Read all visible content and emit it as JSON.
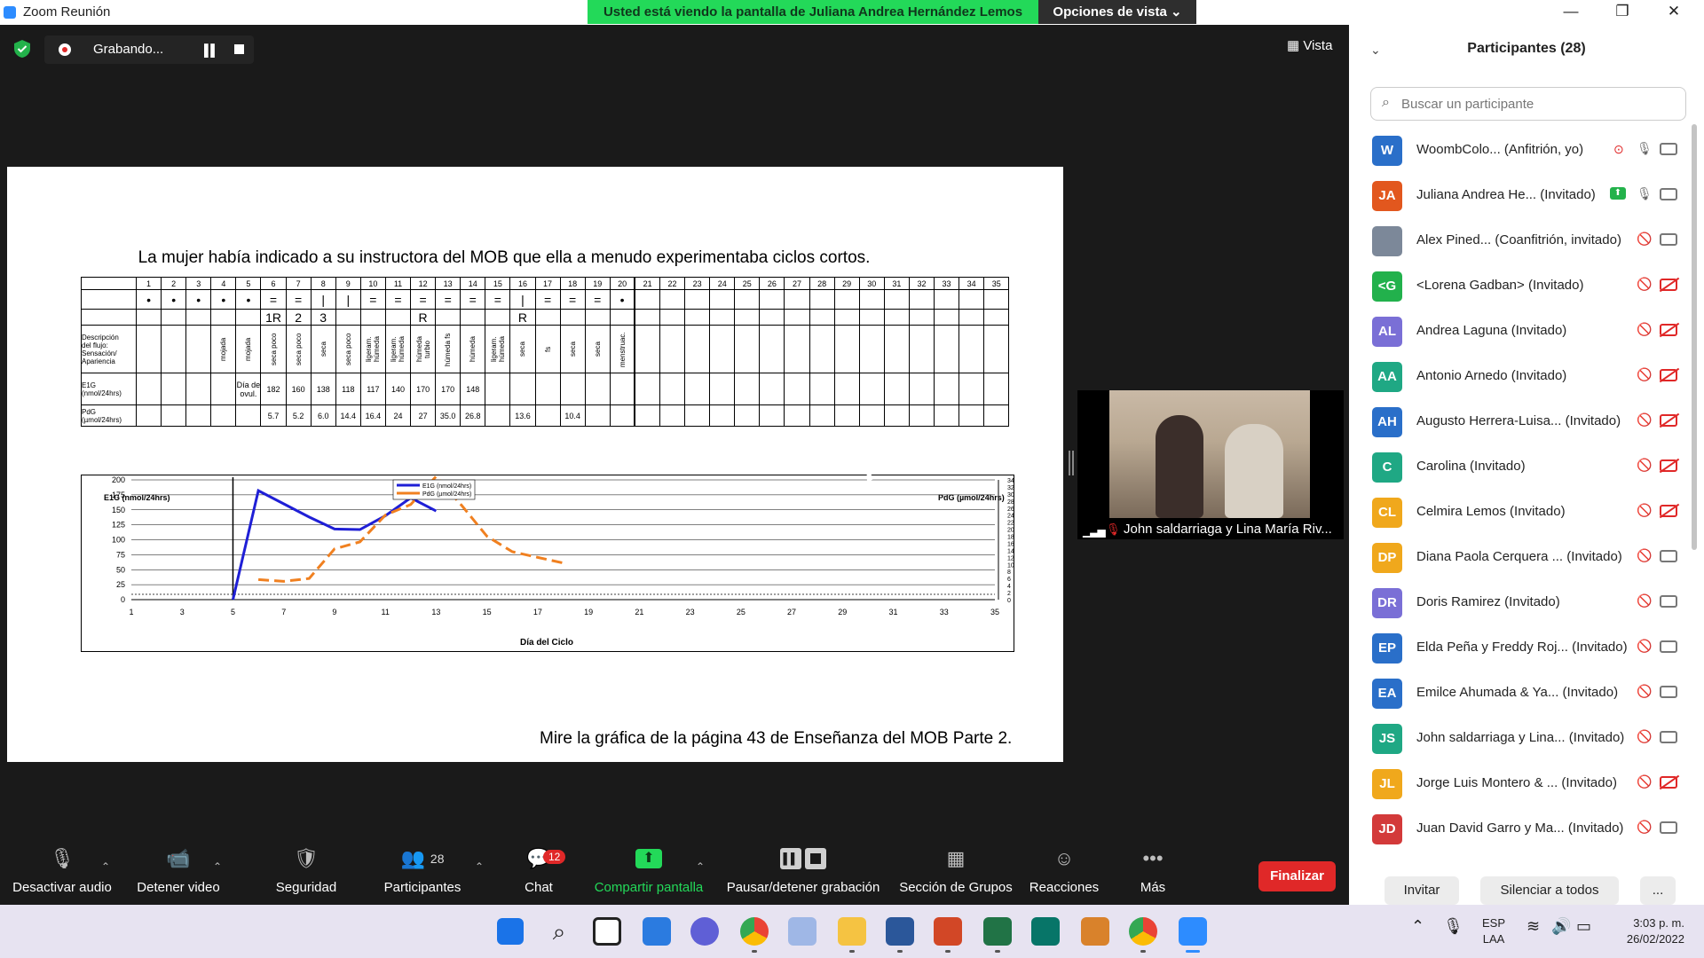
{
  "window": {
    "title": "Zoom Reunión",
    "share_banner": "Usted está viendo la pantalla de Juliana Andrea Hernández Lemos",
    "view_options": "Opciones de vista"
  },
  "recording": {
    "status": "Grabando..."
  },
  "view_button": "Vista",
  "slide": {
    "title": "La mujer había indicado a su instructora del MOB que ella a menudo experimentaba ciclos cortos.",
    "footer": "Mire la gráfica de la página 43 de Enseñanza del MOB Parte 2.",
    "days": [
      "1",
      "2",
      "3",
      "4",
      "5",
      "6",
      "7",
      "8",
      "9",
      "10",
      "11",
      "12",
      "13",
      "14",
      "15",
      "16",
      "17",
      "18",
      "19",
      "20",
      "21",
      "22",
      "23",
      "24",
      "25",
      "26",
      "27",
      "28",
      "29",
      "30",
      "31",
      "32",
      "33",
      "34",
      "35"
    ],
    "symbols": [
      "•",
      "•",
      "•",
      "•",
      "•",
      "=",
      "=",
      "|",
      "|",
      "=",
      "=",
      "=",
      "=",
      "=",
      "=",
      "|",
      "=",
      "=",
      "=",
      "•",
      "",
      "",
      "",
      "",
      "",
      "",
      "",
      "",
      "",
      "",
      "",
      "",
      "",
      "",
      ""
    ],
    "marks": [
      "",
      "",
      "",
      "",
      "",
      "1R",
      "2",
      "3",
      "",
      "",
      "",
      "R",
      "",
      "",
      "",
      "R",
      "",
      "",
      "",
      "",
      "",
      "",
      "",
      "",
      "",
      "",
      "",
      "",
      "",
      "",
      "",
      "",
      "",
      "",
      ""
    ],
    "desc_label": [
      "Descripción",
      "del flujo:",
      "Sensación/",
      "Apariencia"
    ],
    "desc": [
      "",
      "",
      "",
      "mojada",
      "mojada",
      "seca poco",
      "seca poco",
      "seca",
      "seca poco",
      "ligeram. húmeda",
      "ligeram. húmeda",
      "húmeda turbio",
      "húmeda fs",
      "húmeda",
      "ligeram. húmeda",
      "seca",
      "fs",
      "seca",
      "seca",
      "menstruac.",
      "",
      "",
      "",
      "",
      "",
      "",
      "",
      "",
      "",
      "",
      "",
      "",
      "",
      "",
      ""
    ],
    "e1g_label": "E1G (nmol/24hrs)",
    "e1g": [
      "",
      "",
      "",
      "",
      "Día de ovul.",
      "182",
      "160",
      "138",
      "118",
      "117",
      "140",
      "170",
      "170",
      "148",
      "",
      "",
      "",
      "",
      "",
      "",
      "",
      "",
      "",
      "",
      "",
      "",
      "",
      "",
      "",
      "",
      "",
      "",
      "",
      "",
      ""
    ],
    "pdg_label": "PdG (µmol/24hrs)",
    "pdg": [
      "",
      "",
      "",
      "",
      "",
      "5.7",
      "5.2",
      "6.0",
      "14.4",
      "16.4",
      "24",
      "27",
      "35.0",
      "26.8",
      "",
      "13.6",
      "",
      "10.4",
      "",
      "",
      "",
      "",
      "",
      "",
      "",
      "",
      "",
      "",
      "",
      "",
      "",
      "",
      "",
      "",
      ""
    ]
  },
  "chart_data": {
    "type": "line",
    "xlabel": "Día del Ciclo",
    "ylabel": "E1G (nmol/24hrs)",
    "y2label": "PdG (µmol/24hrs)",
    "ylim": [
      0,
      200
    ],
    "y2lim": [
      0,
      34
    ],
    "x_ticks": [
      1,
      3,
      5,
      7,
      9,
      11,
      13,
      15,
      17,
      19,
      21,
      23,
      25,
      27,
      29,
      31,
      33,
      35
    ],
    "y_ticks": [
      0,
      25,
      50,
      75,
      100,
      125,
      150,
      175,
      200
    ],
    "y2_ticks": [
      0,
      2,
      4,
      6,
      8,
      10,
      12,
      14,
      16,
      18,
      20,
      22,
      24,
      26,
      28,
      30,
      32,
      34
    ],
    "legend_position": "top-center",
    "series": [
      {
        "name": "E1G (nmol/24hrs)",
        "color": "#1f1fd6",
        "x": [
          5,
          6,
          7,
          8,
          9,
          10,
          11,
          12,
          13
        ],
        "y": [
          0,
          182,
          160,
          138,
          118,
          117,
          140,
          170,
          148
        ]
      },
      {
        "name": "PdG (µmol/24hrs)",
        "color": "#f08020",
        "x": [
          6,
          7,
          8,
          9,
          10,
          11,
          12,
          13,
          14,
          15,
          16,
          17,
          18
        ],
        "y": [
          5.7,
          5.2,
          6.0,
          14.4,
          16.4,
          24,
          27,
          35.0,
          26.8,
          18,
          13.6,
          12,
          10.4
        ]
      }
    ]
  },
  "video": {
    "name": "John saldarriaga y Lina María Riv..."
  },
  "toolbar": {
    "audio": "Desactivar audio",
    "video": "Detener video",
    "security": "Seguridad",
    "participants": "Participantes",
    "participants_count": "28",
    "chat": "Chat",
    "chat_badge": "12",
    "share": "Compartir pantalla",
    "record": "Pausar/detener grabación",
    "groups": "Sección de Grupos",
    "reactions": "Reacciones",
    "more": "Más",
    "end": "Finalizar"
  },
  "panel": {
    "title": "Participantes (28)",
    "search_placeholder": "Buscar un participante",
    "invite": "Invitar",
    "mute_all": "Silenciar a todos",
    "more": "...",
    "participants": [
      {
        "initials": "W",
        "color": "#2a6fc9",
        "name": "WoombColo...",
        "role": "(Anfitrión, yo)",
        "mic": "on",
        "cam": "on",
        "rec": true
      },
      {
        "initials": "JA",
        "color": "#e2571e",
        "name": "Juliana Andrea He...",
        "role": "(Invitado)",
        "mic": "on",
        "cam": "on",
        "share": true
      },
      {
        "initials": "",
        "color": "#7c8899",
        "name": "Alex Pined...",
        "role": "(Coanfitrión, invitado)",
        "mic": "muted",
        "cam": "on"
      },
      {
        "initials": "<G",
        "color": "#22b14c",
        "name": "<Lorena Gadban>",
        "role": "(Invitado)",
        "mic": "muted",
        "cam": "off"
      },
      {
        "initials": "AL",
        "color": "#7a6fd6",
        "name": "Andrea Laguna",
        "role": "(Invitado)",
        "mic": "muted",
        "cam": "off"
      },
      {
        "initials": "AA",
        "color": "#1fa884",
        "name": "Antonio Arnedo",
        "role": "(Invitado)",
        "mic": "muted",
        "cam": "off"
      },
      {
        "initials": "AH",
        "color": "#2a6fc9",
        "name": "Augusto Herrera-Luisa...",
        "role": "(Invitado)",
        "mic": "muted",
        "cam": "off"
      },
      {
        "initials": "C",
        "color": "#1fa884",
        "name": "Carolina",
        "role": "(Invitado)",
        "mic": "muted",
        "cam": "off"
      },
      {
        "initials": "CL",
        "color": "#f0a81c",
        "name": "Celmira Lemos",
        "role": "(Invitado)",
        "mic": "muted",
        "cam": "off"
      },
      {
        "initials": "DP",
        "color": "#f0a81c",
        "name": "Diana Paola Cerquera ...",
        "role": "(Invitado)",
        "mic": "muted",
        "cam": "on"
      },
      {
        "initials": "DR",
        "color": "#7a6fd6",
        "name": "Doris Ramirez",
        "role": "(Invitado)",
        "mic": "muted",
        "cam": "on"
      },
      {
        "initials": "EP",
        "color": "#2a6fc9",
        "name": "Elda Peña y Freddy Roj...",
        "role": "(Invitado)",
        "mic": "muted",
        "cam": "on"
      },
      {
        "initials": "EA",
        "color": "#2a6fc9",
        "name": "Emilce Ahumada & Ya...",
        "role": "(Invitado)",
        "mic": "muted",
        "cam": "on"
      },
      {
        "initials": "JS",
        "color": "#1fa884",
        "name": "John saldarriaga y Lina...",
        "role": "(Invitado)",
        "mic": "muted",
        "cam": "on"
      },
      {
        "initials": "JL",
        "color": "#f0a81c",
        "name": "Jorge Luis Montero & ...",
        "role": "(Invitado)",
        "mic": "muted",
        "cam": "off"
      },
      {
        "initials": "JD",
        "color": "#d33a3a",
        "name": "Juan David Garro y Ma...",
        "role": "(Invitado)",
        "mic": "muted",
        "cam": "on"
      }
    ]
  },
  "taskbar": {
    "lang": "ESP",
    "lang2": "LAA",
    "time": "3:03 p. m.",
    "date": "26/02/2022"
  }
}
